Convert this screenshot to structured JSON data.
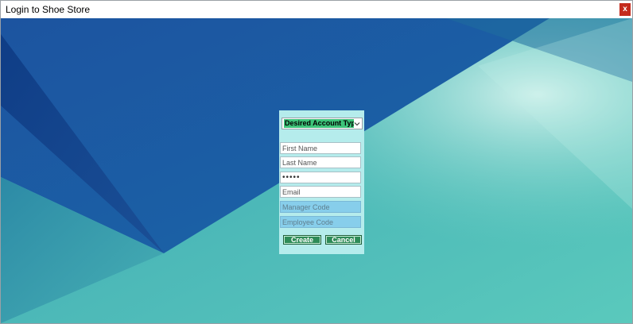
{
  "window": {
    "title": "Login to Shoe Store",
    "close_label": "x"
  },
  "form": {
    "account_type": {
      "selected": "Desired Account Type"
    },
    "fields": {
      "first_name": "First Name",
      "last_name": "Last Name",
      "password": "•••••",
      "email": "Email",
      "manager_code": "Manager Code",
      "employee_code": "Employee Code"
    },
    "buttons": {
      "create": "Create",
      "cancel": "Cancel"
    }
  },
  "colors": {
    "panel": "#b5ecec",
    "button": "#2e8b57",
    "combo_highlight": "#3ec47a",
    "disabled_field": "#87ceeb",
    "close_button": "#c42b1c"
  },
  "icons": {
    "combo_arrow": "chevron-down-icon",
    "close": "close-icon"
  }
}
